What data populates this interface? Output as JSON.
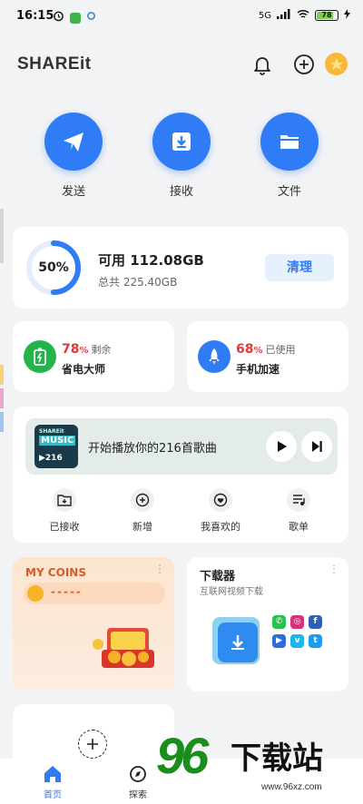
{
  "status_bar": {
    "time": "16:15",
    "network": "5G",
    "battery": "78"
  },
  "header": {
    "logo": "SHAREit",
    "icons": [
      "bell-icon",
      "plus-circle-icon",
      "coin-icon"
    ]
  },
  "actions": [
    {
      "label": "发送",
      "icon": "paper-plane-icon"
    },
    {
      "label": "接收",
      "icon": "download-box-icon"
    },
    {
      "label": "文件",
      "icon": "folder-icon"
    }
  ],
  "storage": {
    "percent": "50%",
    "percent_value": 50,
    "available": "可用 112.08GB",
    "total": "总共 225.40GB",
    "clean_label": "清理"
  },
  "tools": [
    {
      "pct": "78",
      "pct_unit": "%",
      "note": "剩余",
      "name": "省电大师",
      "icon": "battery-icon",
      "color": "#23b54a"
    },
    {
      "pct": "68",
      "pct_unit": "%",
      "note": "已使用",
      "name": "手机加速",
      "icon": "rocket-icon",
      "color": "#2f7cf6"
    }
  ],
  "music": {
    "album_brand": "SHAREit",
    "album_title": "MUSIC",
    "album_count": "▶216",
    "banner_text": "开始播放你的216首歌曲",
    "items": [
      {
        "label": "已接收",
        "icon": "folder-download-icon"
      },
      {
        "label": "新增",
        "icon": "plus-circle-icon"
      },
      {
        "label": "我喜欢的",
        "icon": "heart-icon"
      },
      {
        "label": "歌单",
        "icon": "playlist-icon"
      }
    ]
  },
  "coins": {
    "title": "MY COINS",
    "value": "-----",
    "more": "⋮"
  },
  "downloader": {
    "title": "下载器",
    "subtitle": "互联网视频下载",
    "more": "⋮",
    "social": [
      "whatsapp-icon",
      "instagram-icon",
      "facebook-icon",
      "vimeo-icon",
      "vimeo-alt-icon",
      "twitter-icon"
    ]
  },
  "nav": [
    {
      "label": "首页",
      "icon": "home-icon",
      "active": true
    },
    {
      "label": "探索",
      "icon": "explore-icon",
      "active": false
    }
  ],
  "watermark": {
    "number": "96",
    "text": "下载站",
    "url": "www.96xz.com"
  },
  "colors": {
    "accent": "#2f7cf6",
    "background": "#f2f3f5",
    "red": "#e03a3a",
    "watermark_green": "#1a8e1a"
  }
}
